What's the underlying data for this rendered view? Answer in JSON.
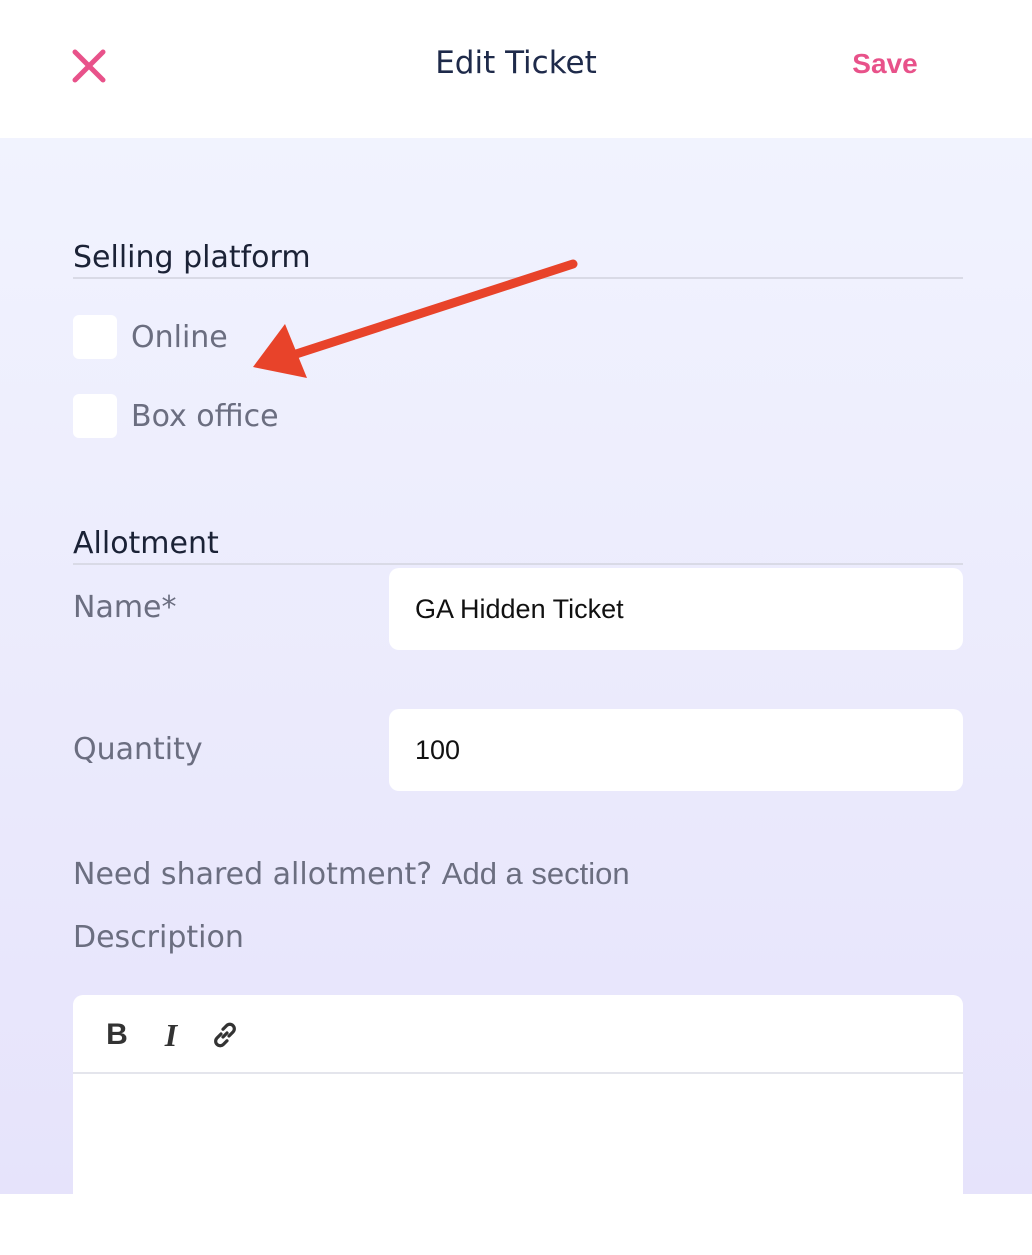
{
  "header": {
    "title": "Edit Ticket",
    "save_label": "Save",
    "close_icon": "close-icon"
  },
  "selling_platform": {
    "heading": "Selling platform",
    "options": [
      {
        "label": "Online",
        "checked": false
      },
      {
        "label": "Box office",
        "checked": false
      }
    ]
  },
  "allotment": {
    "heading": "Allotment",
    "name_label": "Name*",
    "name_value": "GA Hidden Ticket",
    "quantity_label": "Quantity",
    "quantity_value": "100",
    "shared_prompt": "Need shared allotment?",
    "shared_link": "Add a section",
    "description_label": "Description"
  },
  "editor": {
    "toolbar": [
      "bold-icon",
      "italic-icon",
      "link-icon"
    ],
    "bold_glyph": "B",
    "italic_glyph": "I",
    "body_text": ""
  },
  "annotation": {
    "arrow_color": "#e8432a",
    "icon": "red-arrow-annotation"
  },
  "colors": {
    "accent": "#e8528a",
    "title": "#1e2a4a",
    "label": "#6b6e80"
  }
}
